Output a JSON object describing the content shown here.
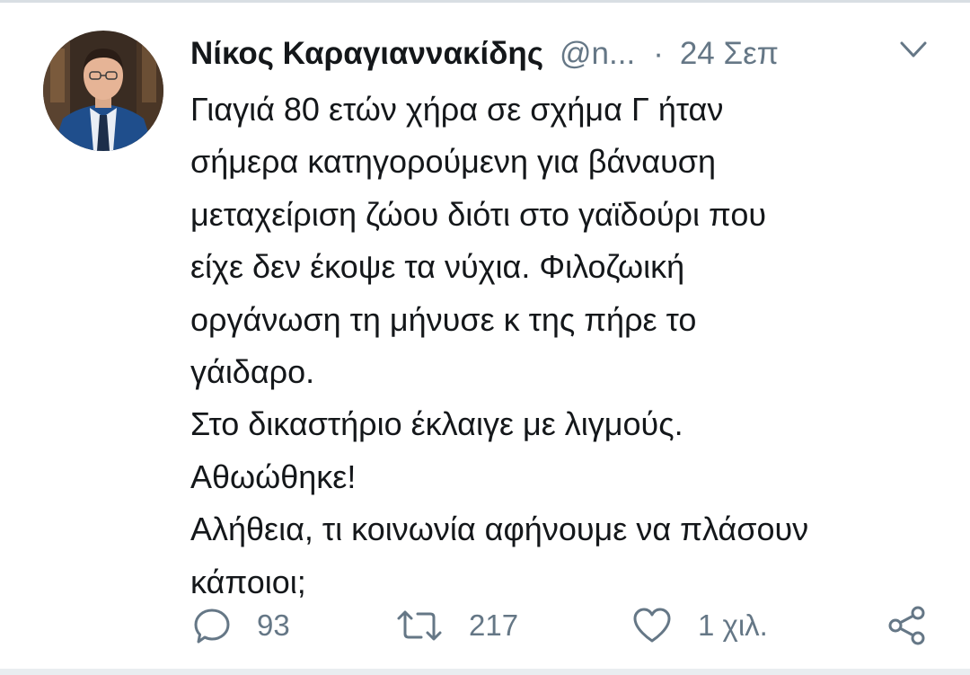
{
  "tweet": {
    "author_name": "Νίκος Καραγιαννακίδης",
    "handle": "@n...",
    "separator": "·",
    "date": "24 Σεπ",
    "text_lines": [
      "Γιαγιά 80 ετών χήρα σε σχήμα Γ ήταν",
      "σήμερα κατηγορούμενη για βάναυση",
      "μεταχείριση ζώου διότι στο γαϊδούρι που",
      "είχε δεν έκοψε τα νύχια. Φιλοζωική",
      "οργάνωση τη μήνυσε κ της πήρε το",
      "γάιδαρο.",
      "Στο δικαστήριο έκλαιγε με λιγμούς.",
      "Αθωώθηκε!",
      "Αλήθεια, τι κοινωνία αφήνουμε να πλάσουν",
      "κάποιοι;"
    ]
  },
  "actions": {
    "reply_icon": "reply-icon",
    "reply_count": "93",
    "retweet_icon": "retweet-icon",
    "retweet_count": "217",
    "like_icon": "heart-icon",
    "like_count": "1 χιλ.",
    "share_icon": "share-icon"
  },
  "colors": {
    "text": "#14171a",
    "secondary": "#657786",
    "divider": "#d8dee3"
  }
}
